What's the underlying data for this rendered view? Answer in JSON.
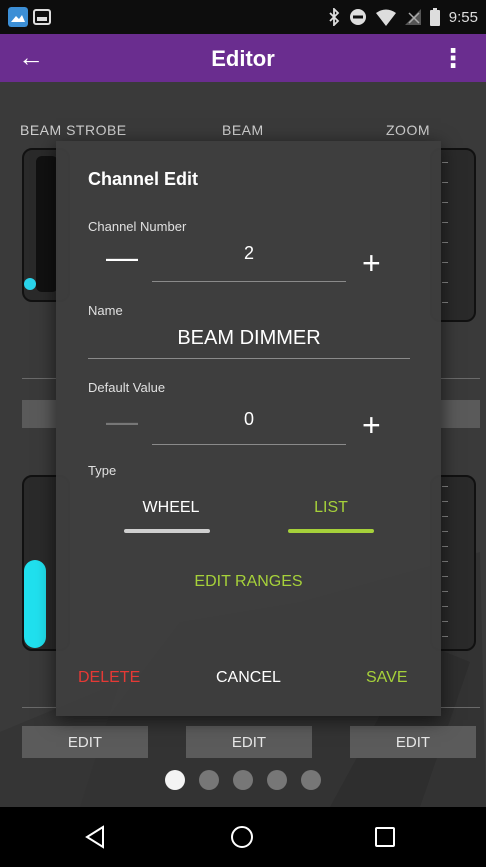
{
  "status_bar": {
    "time": "9:55",
    "icons": [
      "gallery-app-icon",
      "screenshot-icon",
      "bluetooth-icon",
      "do-not-disturb-icon",
      "wifi-icon",
      "no-signal-icon",
      "battery-icon"
    ]
  },
  "app_bar": {
    "title": "Editor",
    "back_icon": "arrow-back-icon",
    "menu_icon": "more-vert-icon"
  },
  "editor": {
    "channel_labels": [
      "BEAM STROBE",
      "BEAM",
      "ZOOM"
    ],
    "edit_buttons": [
      "EDIT",
      "EDIT",
      "EDIT"
    ],
    "page_count": 5,
    "active_page": 1
  },
  "dialog": {
    "title": "Channel Edit",
    "channel_number": {
      "label": "Channel Number",
      "value": "2",
      "minus": "—",
      "plus": "+"
    },
    "name": {
      "label": "Name",
      "value": "BEAM DIMMER"
    },
    "default_value": {
      "label": "Default Value",
      "value": "0",
      "minus": "—",
      "plus": "+"
    },
    "type": {
      "label": "Type",
      "options": [
        "WHEEL",
        "LIST"
      ],
      "selected": "LIST"
    },
    "edit_ranges": "EDIT RANGES",
    "actions": {
      "delete": "DELETE",
      "cancel": "CANCEL",
      "save": "SAVE"
    }
  },
  "nav_bar": {
    "icons": [
      "back-triangle-icon",
      "home-circle-icon",
      "recents-square-icon"
    ]
  },
  "colors": {
    "app_bar": "#6a2d8f",
    "accent_green": "#a6d13a",
    "delete_red": "#e53935",
    "cyan": "#20e0ee"
  }
}
